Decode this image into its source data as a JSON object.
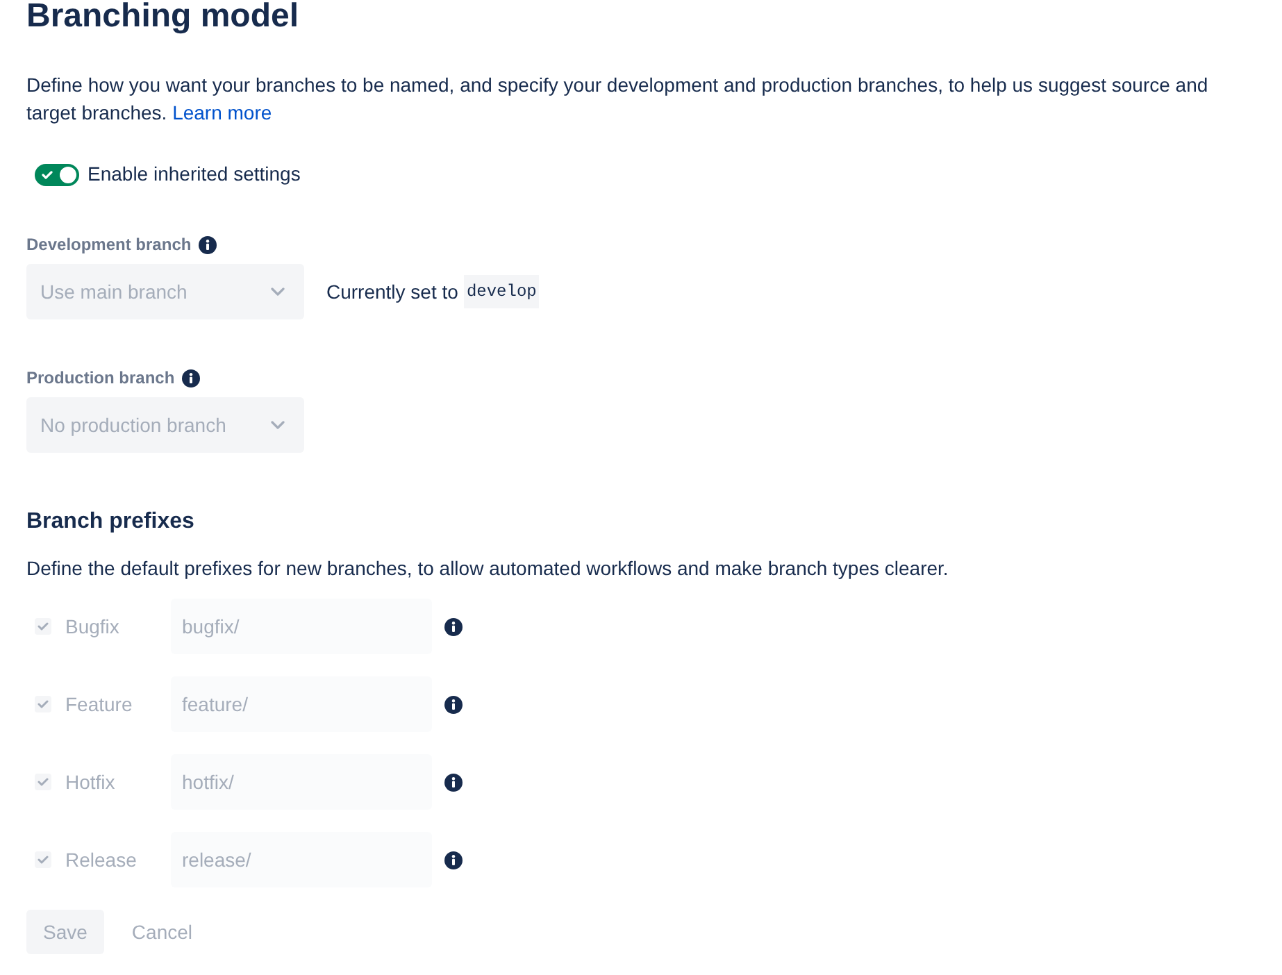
{
  "page": {
    "title": "Branching model",
    "description": "Define how you want your branches to be named, and specify your development and production branches, to help us suggest source and target branches.",
    "learn_more_link": "Learn more"
  },
  "inherit_toggle": {
    "label": "Enable inherited settings",
    "on": true
  },
  "development_branch": {
    "label": "Development branch",
    "select_value": "Use main branch",
    "disabled": true,
    "current_prefix": "Currently set to",
    "current_value": "develop"
  },
  "production_branch": {
    "label": "Production branch",
    "select_value": "No production branch",
    "disabled": true
  },
  "branch_prefixes": {
    "title": "Branch prefixes",
    "description": "Define the default prefixes for new branches, to allow automated workflows and make branch types clearer.",
    "rows": [
      {
        "label": "Bugfix",
        "checked": true,
        "disabled": true,
        "value": "bugfix/"
      },
      {
        "label": "Feature",
        "checked": true,
        "disabled": true,
        "value": "feature/"
      },
      {
        "label": "Hotfix",
        "checked": true,
        "disabled": true,
        "value": "hotfix/"
      },
      {
        "label": "Release",
        "checked": true,
        "disabled": true,
        "value": "release/"
      }
    ]
  },
  "buttons": [
    {
      "label": "Save",
      "kind": "primary",
      "disabled": true
    },
    {
      "label": "Cancel",
      "kind": "subtle",
      "disabled": true
    }
  ]
}
